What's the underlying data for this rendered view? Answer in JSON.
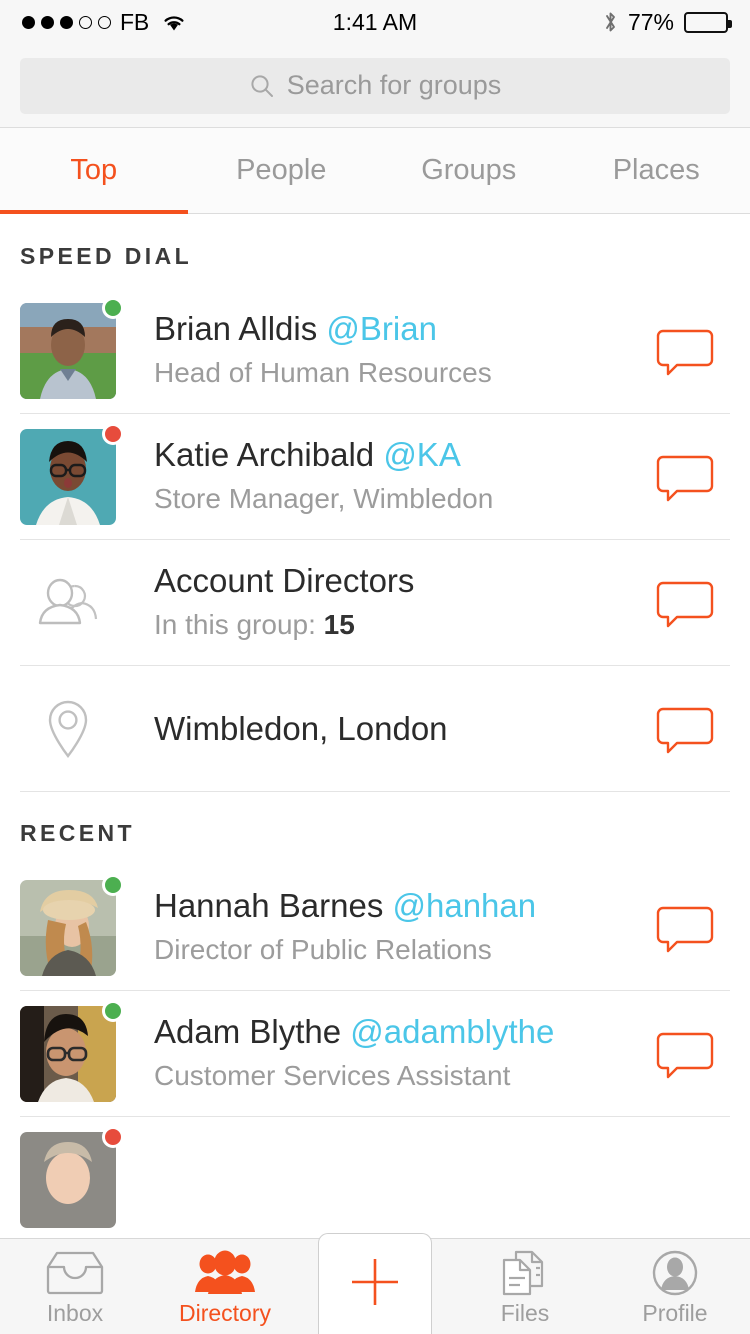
{
  "status_bar": {
    "signal_dots_filled": 3,
    "signal_dots_total": 5,
    "carrier": "FB",
    "wifi_icon": "wifi-icon",
    "time": "1:41 AM",
    "bluetooth_icon": "bluetooth-icon",
    "battery_percent": "77%",
    "battery_level": 77
  },
  "search": {
    "placeholder": "Search for groups",
    "value": "",
    "icon": "search-icon"
  },
  "tabs": {
    "active": "Top",
    "items": [
      {
        "label": "Top",
        "active": true
      },
      {
        "label": "People",
        "active": false
      },
      {
        "label": "Groups",
        "active": false
      },
      {
        "label": "Places",
        "active": false
      }
    ]
  },
  "sections": [
    {
      "header": "SPEED DIAL",
      "rows": [
        {
          "type": "person",
          "name": "Brian Alldis",
          "handle": "@Brian",
          "subtitle": "Head of Human Resources",
          "presence": "online",
          "presence_color": "#4CAF50",
          "avatar_kind": "photo-man-outdoors",
          "action_icon": "chat-bubble-icon"
        },
        {
          "type": "person",
          "name": "Katie Archibald",
          "handle": "@KA",
          "subtitle": "Store Manager, Wimbledon",
          "presence": "busy",
          "presence_color": "#E74C3C",
          "avatar_kind": "photo-woman-teal",
          "action_icon": "chat-bubble-icon"
        },
        {
          "type": "group",
          "name": "Account Directors",
          "handle": "",
          "subtitle_prefix": "In this group: ",
          "member_count": "15",
          "icon": "group-people-icon",
          "action_icon": "chat-bubble-icon"
        },
        {
          "type": "place",
          "name": "Wimbledon, London",
          "icon": "map-pin-icon",
          "action_icon": "chat-bubble-icon"
        }
      ]
    },
    {
      "header": "RECENT",
      "rows": [
        {
          "type": "person",
          "name": "Hannah Barnes",
          "handle": "@hanhan",
          "subtitle": "Director of Public Relations",
          "presence": "online",
          "presence_color": "#4CAF50",
          "avatar_kind": "photo-woman-hat",
          "action_icon": "chat-bubble-icon"
        },
        {
          "type": "person",
          "name": "Adam Blythe",
          "handle": "@adamblythe",
          "subtitle": "Customer Services Assistant",
          "presence": "online",
          "presence_color": "#4CAF50",
          "avatar_kind": "photo-man-glasses",
          "action_icon": "chat-bubble-icon"
        },
        {
          "type": "person_partial",
          "name": "",
          "handle": "",
          "subtitle": "",
          "presence": "busy",
          "presence_color": "#E74C3C",
          "avatar_kind": "photo-partial",
          "action_icon": ""
        }
      ]
    }
  ],
  "bottom_nav": {
    "items": [
      {
        "label": "Inbox",
        "icon": "inbox-tray-icon",
        "active": false
      },
      {
        "label": "Directory",
        "icon": "people-group-icon",
        "active": true
      },
      {
        "label": "Files",
        "icon": "documents-icon",
        "active": false
      },
      {
        "label": "Profile",
        "icon": "person-circle-icon",
        "active": false
      }
    ],
    "fab": {
      "icon": "plus-icon",
      "label": ""
    }
  },
  "colors": {
    "accent": "#F4511E",
    "handle": "#4BC6E8",
    "online": "#4CAF50",
    "busy": "#E74C3C",
    "text_primary": "#2b2b2b",
    "text_secondary": "#9c9c9c"
  }
}
